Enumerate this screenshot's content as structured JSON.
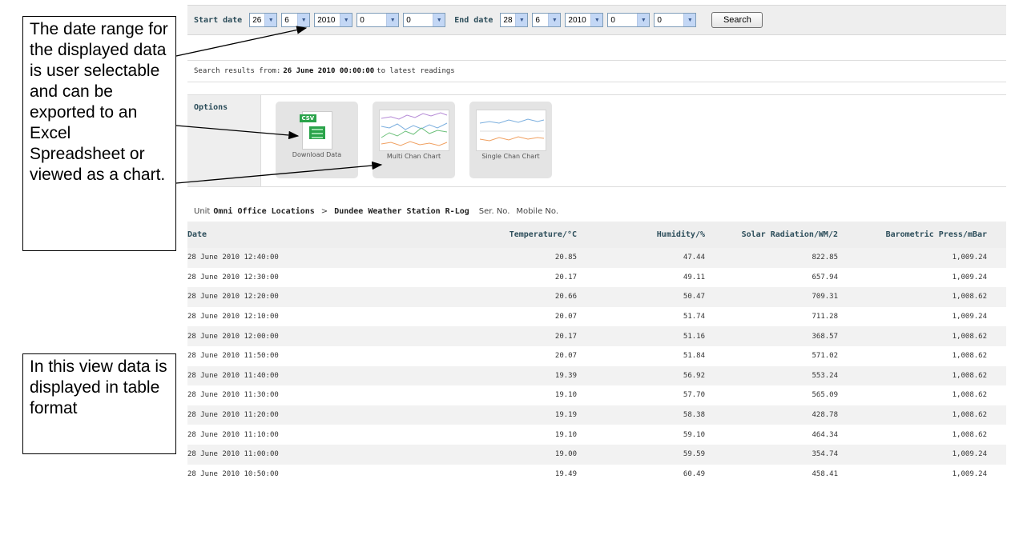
{
  "callouts": {
    "range": "The date range for the displayed data is user selectable and can be exported to an Excel Spreadsheet or viewed as a chart.",
    "table": "In this view data is displayed in table format"
  },
  "date_bar": {
    "start_label": "Start date",
    "end_label": "End date",
    "start": {
      "day": "26",
      "month": "6",
      "year": "2010",
      "hour": "0",
      "minute": "0"
    },
    "end": {
      "day": "28",
      "month": "6",
      "year": "2010",
      "hour": "0",
      "minute": "0"
    },
    "search_label": "Search"
  },
  "results": {
    "prefix": "Search results from:",
    "from": "26 June 2010 00:00:00",
    "suffix": "to latest readings"
  },
  "options": {
    "label": "Options",
    "items": [
      {
        "label": "Download Data",
        "icon": "csv-icon"
      },
      {
        "label": "Multi Chan Chart",
        "icon": "multi-chart-icon"
      },
      {
        "label": "Single Chan Chart",
        "icon": "single-chart-icon"
      }
    ],
    "csv_tag": "CSV"
  },
  "unit": {
    "prefix": "Unit",
    "group": "Omni Office Locations",
    "separator": ">",
    "station": "Dundee Weather Station R-Log",
    "serial": "Ser. No.",
    "mobile": "Mobile No."
  },
  "table": {
    "headers": [
      "Date",
      "Temperature/°C",
      "Humidity/%",
      "Solar Radiation/WM/2",
      "Barometric Press/mBar"
    ],
    "rows": [
      [
        "28 June 2010 12:40:00",
        "20.85",
        "47.44",
        "822.85",
        "1,009.24"
      ],
      [
        "28 June 2010 12:30:00",
        "20.17",
        "49.11",
        "657.94",
        "1,009.24"
      ],
      [
        "28 June 2010 12:20:00",
        "20.66",
        "50.47",
        "709.31",
        "1,008.62"
      ],
      [
        "28 June 2010 12:10:00",
        "20.07",
        "51.74",
        "711.28",
        "1,009.24"
      ],
      [
        "28 June 2010 12:00:00",
        "20.17",
        "51.16",
        "368.57",
        "1,008.62"
      ],
      [
        "28 June 2010 11:50:00",
        "20.07",
        "51.84",
        "571.02",
        "1,008.62"
      ],
      [
        "28 June 2010 11:40:00",
        "19.39",
        "56.92",
        "553.24",
        "1,008.62"
      ],
      [
        "28 June 2010 11:30:00",
        "19.10",
        "57.70",
        "565.09",
        "1,008.62"
      ],
      [
        "28 June 2010 11:20:00",
        "19.19",
        "58.38",
        "428.78",
        "1,008.62"
      ],
      [
        "28 June 2010 11:10:00",
        "19.10",
        "59.10",
        "464.34",
        "1,008.62"
      ],
      [
        "28 June 2010 11:00:00",
        "19.00",
        "59.59",
        "354.74",
        "1,009.24"
      ],
      [
        "28 June 2010 10:50:00",
        "19.49",
        "60.49",
        "458.41",
        "1,009.24"
      ]
    ]
  },
  "colors": {
    "label_teal": "#2c4d5a",
    "panel_grey": "#eeeeee",
    "csv_green": "#2aa34a"
  }
}
